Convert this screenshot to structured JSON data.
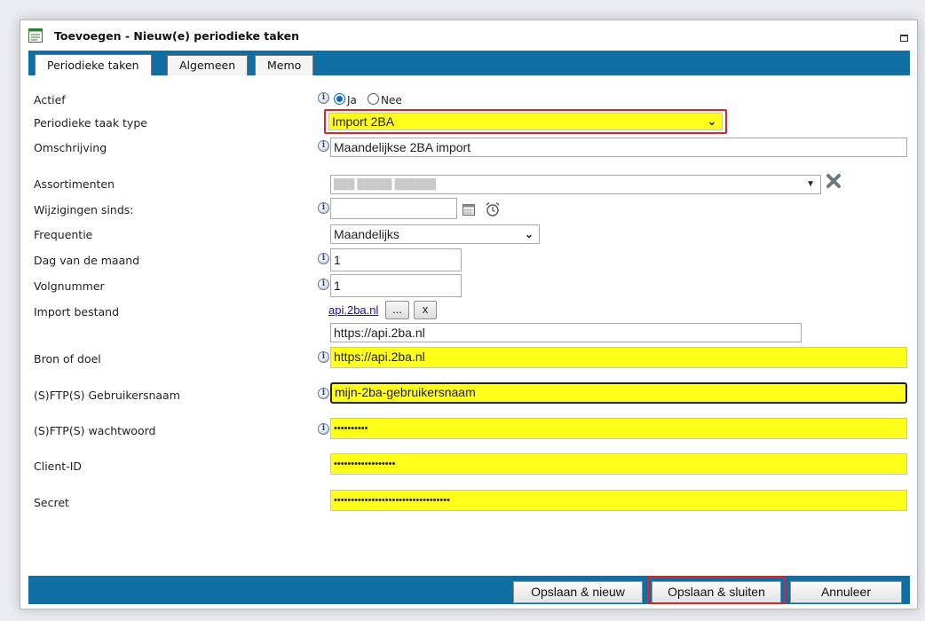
{
  "window": {
    "title": "Toevoegen - Nieuw(e) periodieke taken"
  },
  "tabs": [
    {
      "label": "Periodieke taken",
      "active": true
    },
    {
      "label": "Algemeen",
      "active": false
    },
    {
      "label": "Memo",
      "active": false
    }
  ],
  "form": {
    "actief": {
      "label": "Actief",
      "options": [
        "Ja",
        "Nee"
      ],
      "selected": "Ja"
    },
    "taak_type": {
      "label": "Periodieke taak type",
      "value": "Import 2BA"
    },
    "omschrijving": {
      "label": "Omschrijving",
      "value": "Maandelijkse 2BA import"
    },
    "assortimenten": {
      "label": "Assortimenten",
      "value": "███ █████ ██████"
    },
    "wijzigingen": {
      "label": "Wijzigingen sinds:",
      "value": ""
    },
    "frequentie": {
      "label": "Frequentie",
      "value": "Maandelijks"
    },
    "dag": {
      "label": "Dag van de maand",
      "value": "1"
    },
    "volgnummer": {
      "label": "Volgnummer",
      "value": "1"
    },
    "import_bestand": {
      "label": "Import bestand",
      "link": "api.2ba.nl",
      "browse": "...",
      "clear": "x",
      "value": "https://api.2ba.nl"
    },
    "bron": {
      "label": "Bron of doel",
      "value": "https://api.2ba.nl"
    },
    "gebruiker": {
      "label": "(S)FTP(S) Gebruikersnaam",
      "value": "mijn-2ba-gebruikersnaam"
    },
    "wachtwoord": {
      "label": "(S)FTP(S) wachtwoord",
      "value": "••••••••••"
    },
    "client_id": {
      "label": "Client-ID",
      "value": "••••••••••••••••••"
    },
    "secret": {
      "label": "Secret",
      "value": "••••••••••••••••••••••••••••••••••"
    }
  },
  "footer": {
    "save_new": "Opslaan & nieuw",
    "save_close": "Opslaan & sluiten",
    "cancel": "Annuleer"
  },
  "icons": {
    "info": "info-icon",
    "calendar": "calendar-icon",
    "clock": "alarm-clock-icon",
    "remove": "remove-x-icon"
  },
  "colors": {
    "header_blue": "#0f6ea3",
    "highlight_yellow": "#ffff19",
    "annotation_red": "#e5202b"
  }
}
